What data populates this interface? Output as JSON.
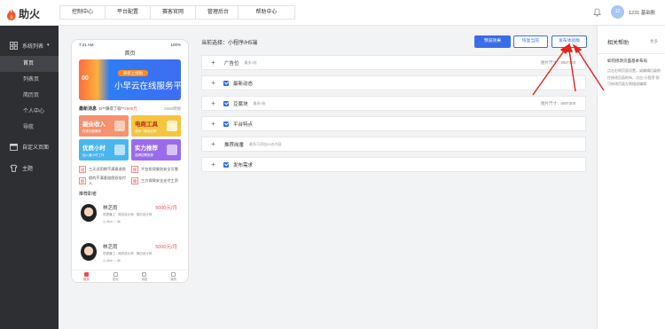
{
  "app": {
    "name": "助火"
  },
  "topnav": {
    "items": [
      "控制中心",
      "平台配置",
      "赛客官网",
      "管理后台"
    ],
    "help_center": "帮助中心"
  },
  "user": {
    "avatar_text": "12",
    "name": "1231 基础账"
  },
  "sidebar": {
    "group": "系统列表",
    "items": [
      "首页",
      "列表页",
      "简历页",
      "个人中心",
      "导航"
    ],
    "active_index": 0,
    "sections": [
      "自定义页面",
      "主题"
    ]
  },
  "phone": {
    "status_time": "7:21 AM",
    "status_battery": "100%",
    "title": "首页",
    "banner": {
      "tag": "来新上线啦",
      "text": "小早云在线服务平",
      "coin": "00"
    },
    "notice": {
      "label": "最新消息",
      "text": "D**赚得了取**",
      "amount": "2500元",
      "more": "2558转换"
    },
    "tiles": [
      {
        "title": "副业收入",
        "sub": "在家也能赚钱"
      },
      {
        "title": "电商工具",
        "sub": "选择一款适合的"
      },
      {
        "title": "优质小时",
        "sub": "加入赚小时工作"
      },
      {
        "title": "实力推荐",
        "sub": "品牌招聘推荐"
      }
    ],
    "features": [
      {
        "icon": "试",
        "text": "三天试用期不满意退款"
      },
      {
        "icon": "保",
        "text": "平台担保服务安全可靠"
      },
      {
        "icon": "假",
        "text": "假的不满意赔偿双倍付入"
      },
      {
        "icon": "障",
        "text": "三方保障安全支付工资"
      }
    ],
    "section": "推荐职者",
    "jobs": [
      {
        "name": "林芝雨",
        "salary": "5000元/月",
        "desc": "项提兼工 · 简历设计师 · 简历设计师",
        "meta": "◷ 4km  ♡ 48"
      },
      {
        "name": "林芝雨",
        "salary": "5000元/月",
        "desc": "项提兼工 · 简历设计师 · 简历设计师",
        "meta": "◷ 4km  ♡ 48"
      }
    ],
    "tabs": [
      "首页",
      "发现",
      "消息",
      "我的"
    ]
  },
  "editor": {
    "current_label": "当前选择：小程序/H5端",
    "buttons": {
      "preview": "预览效果",
      "restore": "恢复当前",
      "publish": "发布体验版"
    },
    "rows": [
      {
        "checked": false,
        "name": "广告位",
        "note": "最多3张",
        "size": "图片尺寸：690*300"
      },
      {
        "checked": true,
        "name": "最新动态",
        "note": "",
        "size": ""
      },
      {
        "checked": true,
        "name": "豆腐块",
        "note": "最多4张",
        "size": "图片尺寸：690*300"
      },
      {
        "checked": true,
        "name": "平台特点",
        "note": "",
        "size": ""
      },
      {
        "checked": false,
        "name": "推荐岗番",
        "note": "最多可添加20名内容",
        "size": ""
      },
      {
        "checked": true,
        "name": "发布需求",
        "note": "",
        "size": ""
      }
    ]
  },
  "help": {
    "title": "相关帮助",
    "more": "更多",
    "question": "如何修改页面基本布局",
    "answer": "点击右侧页面设置，或编辑后级前往修改页面的布，点击“小程序”即可修改页面左侧描述编辑"
  },
  "colors": {
    "accent": "#3a6ee8",
    "sidebar": "#2e2f33",
    "danger": "#f24b4b",
    "annotation": "#e5221c"
  }
}
